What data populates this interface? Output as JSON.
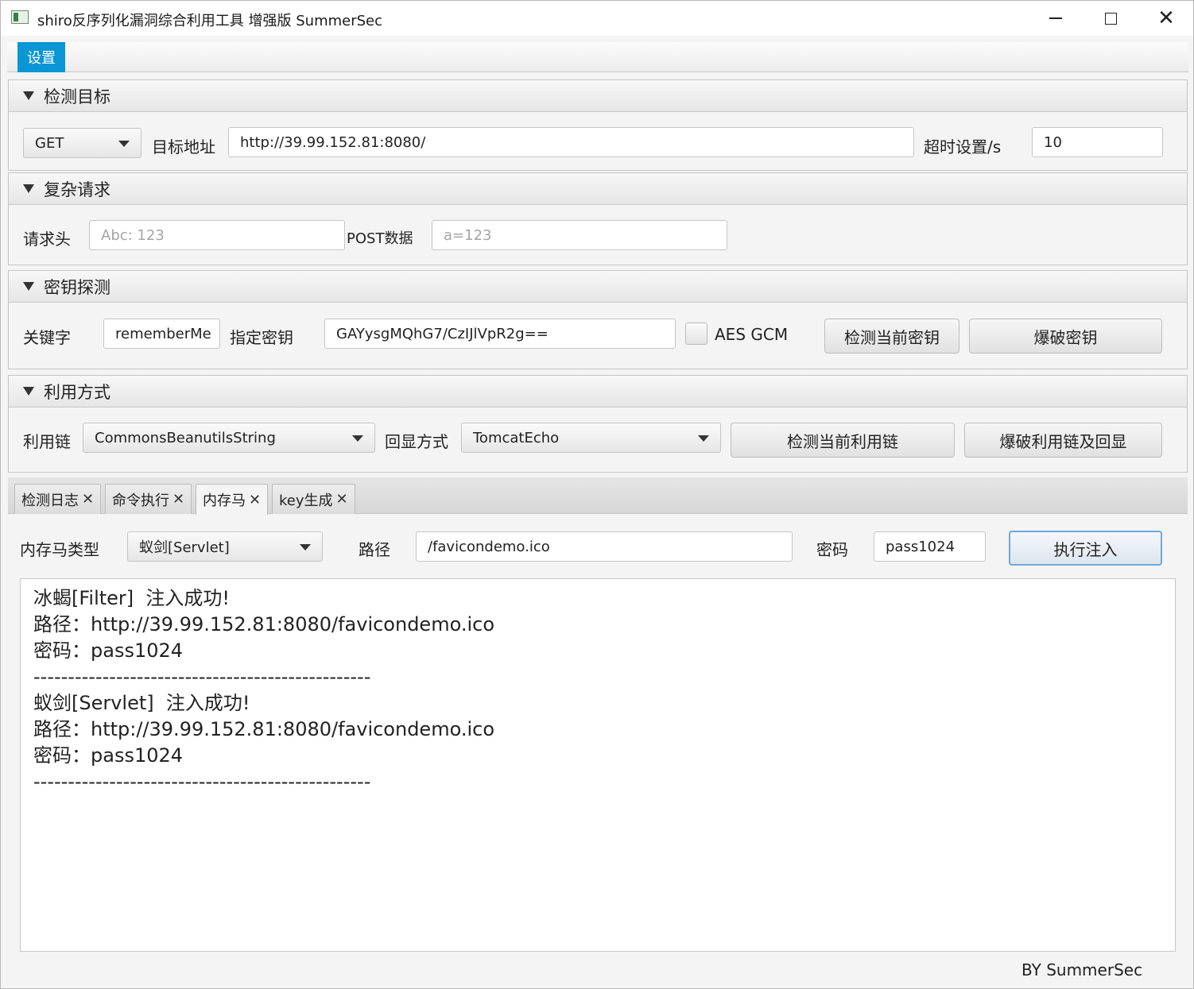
{
  "window": {
    "title": "shiro反序列化漏洞综合利用工具 增强版 SummerSec",
    "minimize_symbol": "",
    "maximize_symbol": "",
    "close_symbol": "✕"
  },
  "menu": {
    "settings_label": "设置"
  },
  "target_pane": {
    "title": "检测目标",
    "method": "GET",
    "url_label": "目标地址",
    "url_value": "http://39.99.152.81:8080/",
    "timeout_label": "超时设置/s",
    "timeout_value": "10"
  },
  "request_pane": {
    "title": "复杂请求",
    "headers_label": "请求头",
    "headers_placeholder": "Abc: 123",
    "post_label": "POST数据",
    "post_placeholder": "a=123"
  },
  "key_pane": {
    "title": "密钥探测",
    "keyword_label": "关键字",
    "keyword_value": "rememberMe",
    "key_label": "指定密钥",
    "key_value": "GAYysgMQhG7/CzIJlVpR2g==",
    "aes_gcm_label": "AES GCM",
    "aes_gcm_checked": false,
    "check_key_button": "检测当前密钥",
    "brute_key_button": "爆破密钥"
  },
  "exploit_pane": {
    "title": "利用方式",
    "chain_label": "利用链",
    "chain_value": "CommonsBeanutilsString",
    "echo_label": "回显方式",
    "echo_value": "TomcatEcho",
    "check_chain_button": "检测当前利用链",
    "brute_chain_button": "爆破利用链及回显"
  },
  "tabs": [
    {
      "label": "检测日志",
      "active": false
    },
    {
      "label": "命令执行",
      "active": false
    },
    {
      "label": "内存马",
      "active": true
    },
    {
      "label": "key生成",
      "active": false
    }
  ],
  "tab_close_symbol": "✕",
  "memshell": {
    "type_label": "内存马类型",
    "type_value": "蚁剑[Servlet]",
    "path_label": "路径",
    "path_value": "/favicondemo.ico",
    "password_label": "密码",
    "password_value": "pass1024",
    "inject_button": "执行注入"
  },
  "output_lines": [
    "冰蝎[Filter]  注入成功!",
    "路径：http://39.99.152.81:8080/favicondemo.ico",
    "密码：pass1024",
    "-------------------------------------------------",
    "蚁剑[Servlet]  注入成功!",
    "路径：http://39.99.152.81:8080/favicondemo.ico",
    "密码：pass1024",
    "-------------------------------------------------"
  ],
  "footer": "BY    SummerSec"
}
